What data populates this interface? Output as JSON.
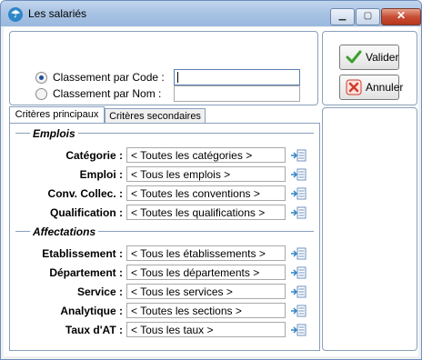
{
  "window": {
    "title": "Les salariés",
    "icon": "app-umbrella-icon",
    "controls": {
      "minimize": "▁",
      "maximize": "▢",
      "close": "✕"
    }
  },
  "sort": {
    "code_label": "Classement par Code :",
    "name_label": "Classement par Nom :",
    "selected": "code",
    "code_value": "",
    "name_value": ""
  },
  "tabs": [
    {
      "label": "Critères principaux",
      "active": true
    },
    {
      "label": "Critères secondaires",
      "active": false
    }
  ],
  "groups": {
    "emplois": {
      "title": "Emplois",
      "fields": [
        {
          "label": "Catégorie :",
          "value": "< Toutes les catégories >"
        },
        {
          "label": "Emploi :",
          "value": "< Tous les emplois >"
        },
        {
          "label": "Conv. Collec. :",
          "value": "< Toutes les conventions >"
        },
        {
          "label": "Qualification :",
          "value": "< Toutes les qualifications >"
        }
      ]
    },
    "affectations": {
      "title": "Affectations",
      "fields": [
        {
          "label": "Etablissement :",
          "value": "< Tous les établissements >"
        },
        {
          "label": "Département :",
          "value": "< Tous les départements >"
        },
        {
          "label": "Service :",
          "value": "< Tous les services >"
        },
        {
          "label": "Analytique :",
          "value": "< Toutes les sections >"
        },
        {
          "label": "Taux d'AT :",
          "value": "< Tous les taux >"
        }
      ]
    }
  },
  "buttons": {
    "validate": "Valider",
    "cancel": "Annuler"
  },
  "colors": {
    "accent": "#2f86c8",
    "check_green": "#3aa02b",
    "cancel_red": "#d23b2b",
    "panel_border": "#8aa0bd"
  }
}
